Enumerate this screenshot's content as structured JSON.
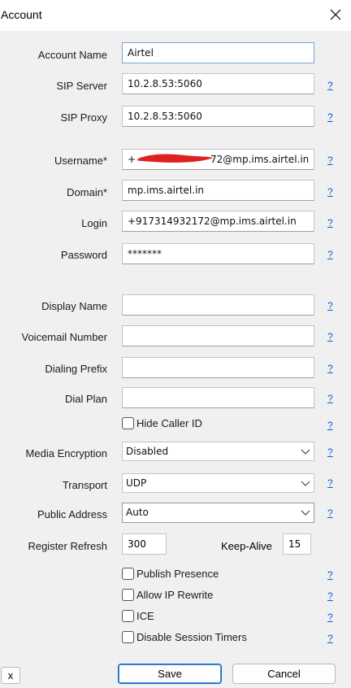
{
  "window": {
    "title": "Account"
  },
  "fields": {
    "account_name": {
      "label": "Account Name",
      "value": "Airtel"
    },
    "sip_server": {
      "label": "SIP Server",
      "value": "10.2.8.53:5060"
    },
    "sip_proxy": {
      "label": "SIP Proxy",
      "value": "10.2.8.53:5060"
    },
    "username": {
      "label": "Username",
      "value": "+917314932172@mp.ims.airtel.in",
      "shown_suffix": "72@mp.ims.airtel.in",
      "shown_prefix": "+"
    },
    "domain": {
      "label": "Domain",
      "value": "mp.ims.airtel.in"
    },
    "login": {
      "label": "Login",
      "value": "+917314932172@mp.ims.airtel.in"
    },
    "password": {
      "label": "Password",
      "value": "*******"
    },
    "display_name": {
      "label": "Display Name",
      "value": ""
    },
    "voicemail_number": {
      "label": "Voicemail Number",
      "value": ""
    },
    "dialing_prefix": {
      "label": "Dialing Prefix",
      "value": ""
    },
    "dial_plan": {
      "label": "Dial Plan",
      "value": ""
    },
    "media_encryption": {
      "label": "Media Encryption",
      "value": "Disabled"
    },
    "transport": {
      "label": "Transport",
      "value": "UDP"
    },
    "public_address": {
      "label": "Public Address",
      "value": "Auto"
    },
    "register_refresh": {
      "label": "Register Refresh",
      "value": "300"
    },
    "keep_alive": {
      "label": "Keep-Alive",
      "value": "15"
    }
  },
  "required_mark": "*",
  "help_glyph": "?",
  "checkboxes": {
    "hide_caller_id": {
      "label": "Hide Caller ID",
      "checked": false
    },
    "publish_presence": {
      "label": "Publish Presence",
      "checked": false
    },
    "allow_ip_rewrite": {
      "label": "Allow IP Rewrite",
      "checked": false
    },
    "ice": {
      "label": "ICE",
      "checked": false
    },
    "disable_session_timers": {
      "label": "Disable Session Timers",
      "checked": false
    }
  },
  "buttons": {
    "save": "Save",
    "cancel": "Cancel",
    "x": "x"
  },
  "colors": {
    "help_link": "#0b5fd0",
    "redaction": "#e02020",
    "primary_border": "#0a64c8"
  },
  "icons": {
    "close": "close-icon",
    "dropdown": "chevron-down-icon"
  }
}
